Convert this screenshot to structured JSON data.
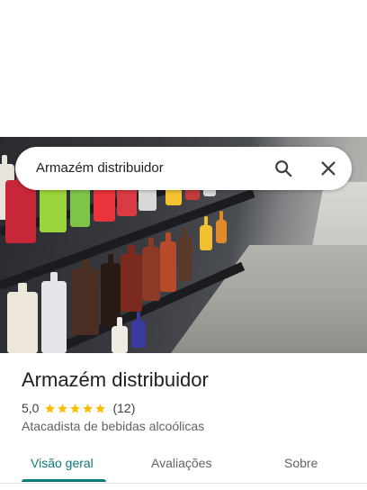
{
  "search": {
    "query": "Armazém distribuidor"
  },
  "place": {
    "name": "Armazém distribuidor",
    "rating": "5,0",
    "stars": 5,
    "review_count": "(12)",
    "category": "Atacadista de bebidas alcoólicas"
  },
  "tabs": [
    {
      "label": "Visão geral",
      "active": true
    },
    {
      "label": "Avaliações",
      "active": false
    },
    {
      "label": "Sobre",
      "active": false
    }
  ],
  "colors": {
    "accent": "#0b7a7a",
    "star": "#fbbc04"
  },
  "icons": {
    "search": "search-icon",
    "close": "close-icon"
  }
}
